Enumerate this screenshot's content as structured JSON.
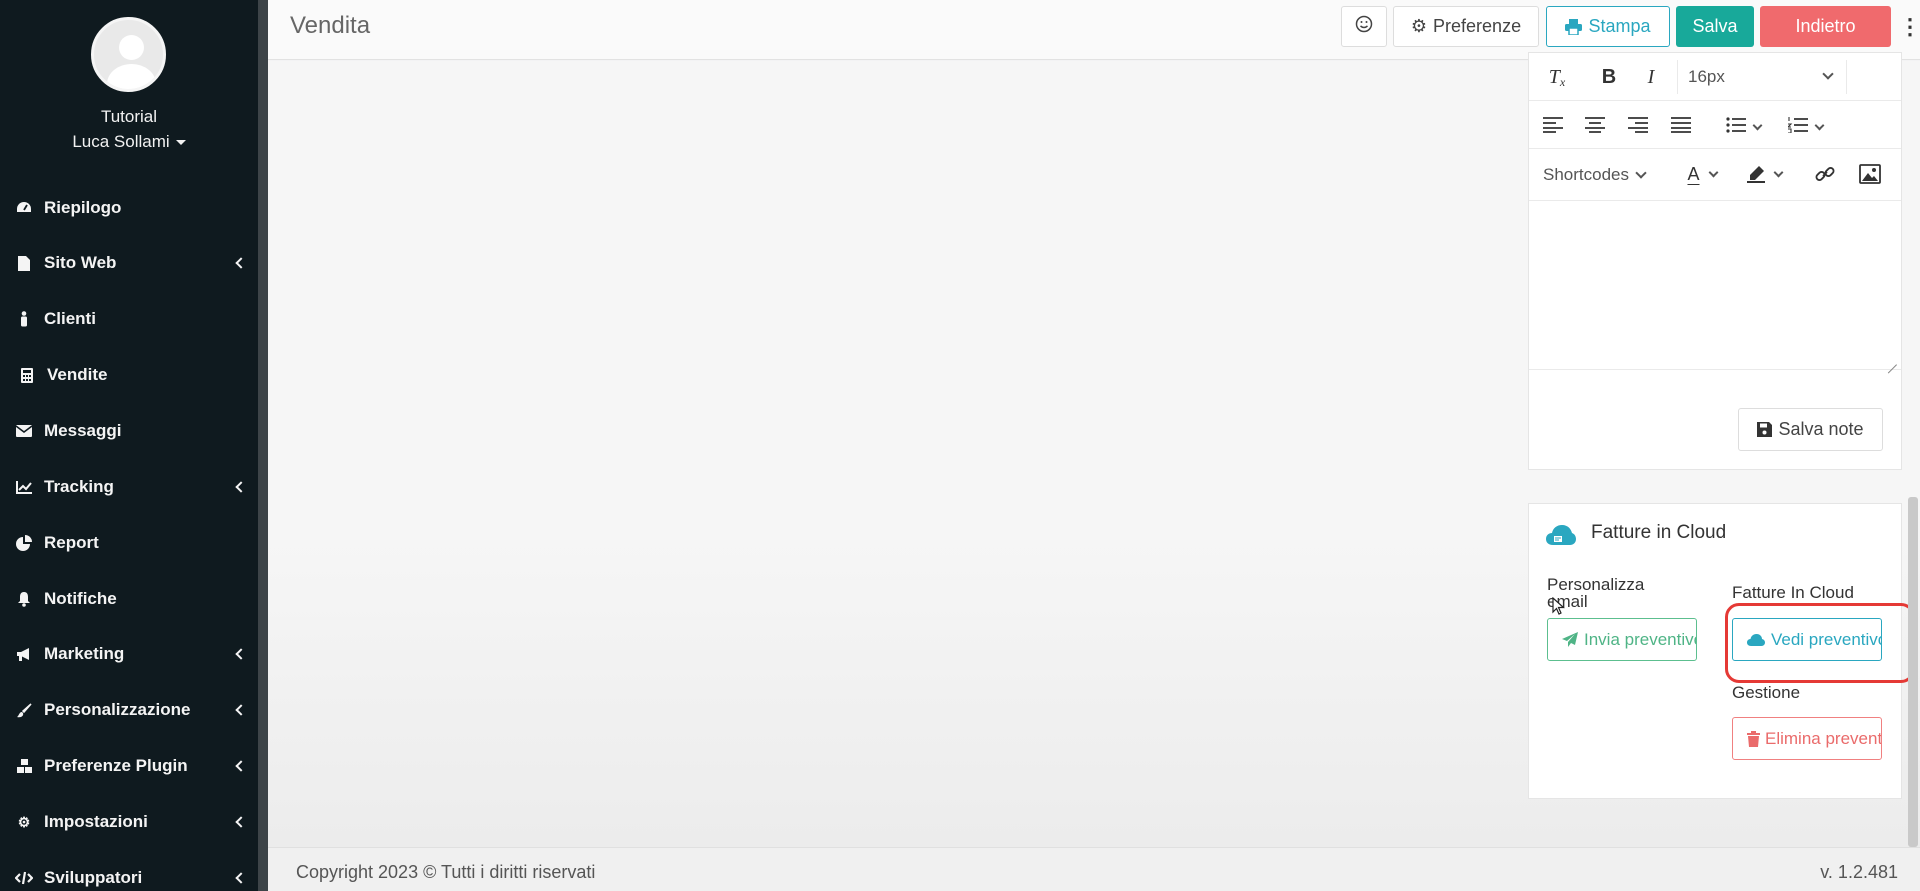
{
  "sidebar": {
    "profile": {
      "org": "Tutorial",
      "name": "Luca Sollami"
    },
    "items": [
      {
        "label": "Riepilogo",
        "icon": "dashboard-icon",
        "submenu": false
      },
      {
        "label": "Sito Web",
        "icon": "file-icon",
        "submenu": true
      },
      {
        "label": "Clienti",
        "icon": "person-icon",
        "submenu": false
      },
      {
        "label": "Vendite",
        "icon": "calculator-icon",
        "submenu": false
      },
      {
        "label": "Messaggi",
        "icon": "envelope-icon",
        "submenu": false
      },
      {
        "label": "Tracking",
        "icon": "line-chart-icon",
        "submenu": true
      },
      {
        "label": "Report",
        "icon": "pie-chart-icon",
        "submenu": false
      },
      {
        "label": "Notifiche",
        "icon": "bell-icon",
        "submenu": false
      },
      {
        "label": "Marketing",
        "icon": "megaphone-icon",
        "submenu": true
      },
      {
        "label": "Personalizzazione",
        "icon": "brush-icon",
        "submenu": true
      },
      {
        "label": "Preferenze Plugin",
        "icon": "cubes-icon",
        "submenu": true
      },
      {
        "label": "Impostazioni",
        "icon": "gear-icon",
        "submenu": true
      },
      {
        "label": "Sviluppatori",
        "icon": "code-icon",
        "submenu": true
      }
    ]
  },
  "header": {
    "title": "Vendita",
    "buttons": {
      "preferences": "Preferenze",
      "print": "Stampa",
      "save": "Salva",
      "back": "Indietro"
    }
  },
  "editor": {
    "font_size": "16px",
    "shortcodes": "Shortcodes",
    "save_notes": "Salva note"
  },
  "fatture": {
    "title": "Fatture in Cloud",
    "personalizza_label": "Personalizza email",
    "personalizza_line1": "Personalizza",
    "personalizza_line2": "email",
    "cloud_label": "Fatture In Cloud",
    "gestione_label": "Gestione",
    "send_button": "Invia preventivo",
    "view_button": "Vedi preventivo",
    "delete_button": "Elimina preventivo"
  },
  "footer": {
    "copyright": "Copyright 2023 © Tutti i diritti riservati",
    "version": "v. 1.2.481"
  },
  "colors": {
    "sidebar_bg": "#0f1a1f",
    "save_green": "#18a99a",
    "back_red": "#f06a6d",
    "accent_blue": "#2aa7c0",
    "highlight_red": "#e53935"
  }
}
